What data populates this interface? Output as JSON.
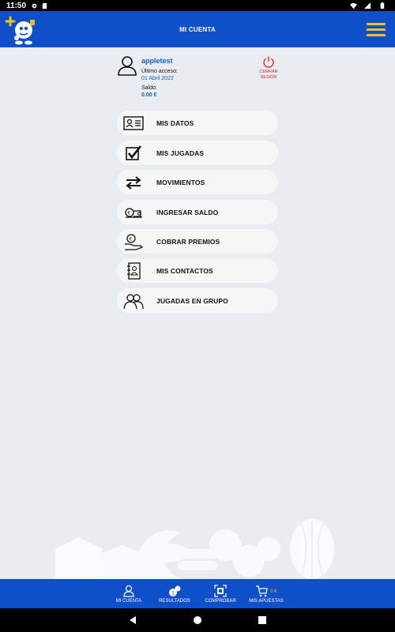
{
  "status_bar": {
    "time": "11:50"
  },
  "header": {
    "title": "MI CUENTA"
  },
  "user": {
    "username": "appletest",
    "last_access_label": "Último acceso:",
    "last_access_value": "01 Abril 2022",
    "balance_label": "Saldo:",
    "balance_value": "0.00 €",
    "logout_line1": "CERRAR",
    "logout_line2": "SESIÓN"
  },
  "menu": {
    "items": [
      {
        "label": "MIS DATOS",
        "icon": "id-card-icon"
      },
      {
        "label": "MIS JUGADAS",
        "icon": "checkbox-icon"
      },
      {
        "label": "MOVIMIENTOS",
        "icon": "transfer-arrows-icon"
      },
      {
        "label": "INGRESAR SALDO",
        "icon": "money-deposit-icon"
      },
      {
        "label": "COBRAR PREMIOS",
        "icon": "collect-prize-icon"
      },
      {
        "label": "MIS CONTACTOS",
        "icon": "contacts-book-icon"
      },
      {
        "label": "JUGADAS EN GRUPO",
        "icon": "group-icon"
      }
    ]
  },
  "bottom_nav": {
    "items": [
      {
        "label": "MI CUENTA",
        "icon": "user-icon"
      },
      {
        "label": "RESULTADOS",
        "icon": "lottery-balls-icon"
      },
      {
        "label": "COMPROBAR",
        "icon": "qr-scan-icon"
      },
      {
        "label": "MIS APUESTAS",
        "icon": "cart-icon",
        "amount": "0 €"
      }
    ]
  },
  "colors": {
    "primary": "#0f4fc9",
    "accent": "#f4c21a",
    "link": "#1a5cc8",
    "danger": "#dd2222",
    "background": "#e9edf2",
    "item_bg": "#f6f6f6"
  }
}
